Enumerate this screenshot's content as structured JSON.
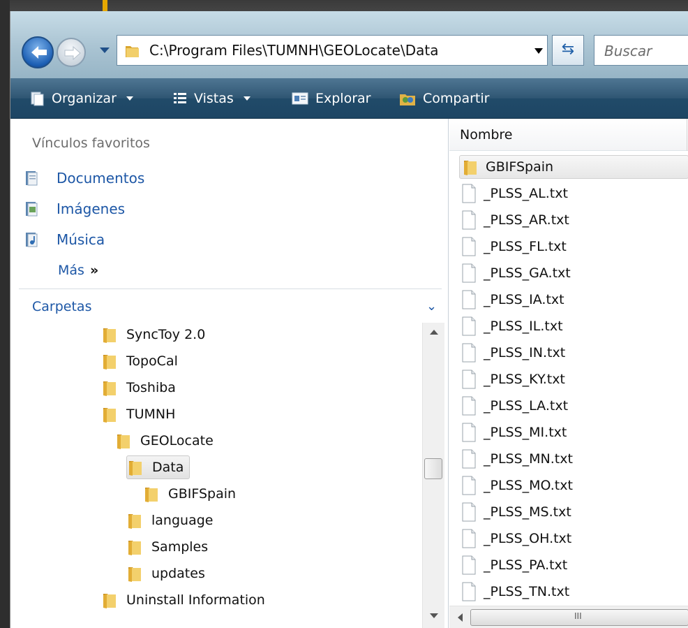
{
  "address": {
    "path": "C:\\Program Files\\TUMNH\\GEOLocate\\Data",
    "search_placeholder": "Buscar"
  },
  "toolbar": {
    "organize": "Organizar",
    "views": "Vistas",
    "explore": "Explorar",
    "share": "Compartir"
  },
  "favorites": {
    "header": "Vínculos favoritos",
    "items": [
      {
        "label": "Documentos",
        "icon": "documents-icon"
      },
      {
        "label": "Imágenes",
        "icon": "pictures-icon"
      },
      {
        "label": "Música",
        "icon": "music-icon"
      }
    ],
    "more": "Más",
    "more_glyph": "»"
  },
  "folders": {
    "header": "Carpetas",
    "tree": [
      {
        "label": "SyncToy 2.0",
        "level": 0
      },
      {
        "label": "TopoCal",
        "level": 0
      },
      {
        "label": "Toshiba",
        "level": 0
      },
      {
        "label": "TUMNH",
        "level": 0
      },
      {
        "label": "GEOLocate",
        "level": 1
      },
      {
        "label": "Data",
        "level": 2,
        "selected": true
      },
      {
        "label": "GBIFSpain",
        "level": 3
      },
      {
        "label": "language",
        "level": 2
      },
      {
        "label": "Samples",
        "level": 2
      },
      {
        "label": "updates",
        "level": 2
      },
      {
        "label": "Uninstall Information",
        "level": 0
      }
    ]
  },
  "files": {
    "column_name": "Nombre",
    "items": [
      {
        "name": "GBIFSpain",
        "type": "folder"
      },
      {
        "name": "_PLSS_AL.txt",
        "type": "file"
      },
      {
        "name": "_PLSS_AR.txt",
        "type": "file"
      },
      {
        "name": "_PLSS_FL.txt",
        "type": "file"
      },
      {
        "name": "_PLSS_GA.txt",
        "type": "file"
      },
      {
        "name": "_PLSS_IA.txt",
        "type": "file"
      },
      {
        "name": "_PLSS_IL.txt",
        "type": "file"
      },
      {
        "name": "_PLSS_IN.txt",
        "type": "file"
      },
      {
        "name": "_PLSS_KY.txt",
        "type": "file"
      },
      {
        "name": "_PLSS_LA.txt",
        "type": "file"
      },
      {
        "name": "_PLSS_MI.txt",
        "type": "file"
      },
      {
        "name": "_PLSS_MN.txt",
        "type": "file"
      },
      {
        "name": "_PLSS_MO.txt",
        "type": "file"
      },
      {
        "name": "_PLSS_MS.txt",
        "type": "file"
      },
      {
        "name": "_PLSS_OH.txt",
        "type": "file"
      },
      {
        "name": "_PLSS_PA.txt",
        "type": "file"
      },
      {
        "name": "_PLSS_TN.txt",
        "type": "file"
      }
    ]
  },
  "colors": {
    "link": "#1d57a6",
    "toolbar": "#2f5673",
    "folder": "#e8b94a"
  }
}
